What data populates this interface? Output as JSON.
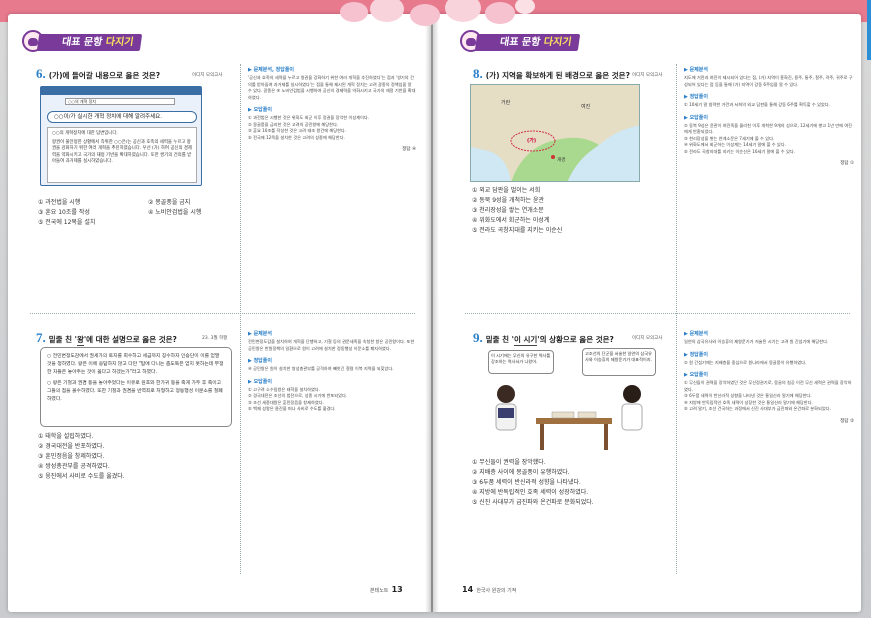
{
  "header": {
    "section_label_a": "대표 문항",
    "section_label_b": "다지기"
  },
  "left": {
    "q6": {
      "number": "6.",
      "title": "(가)에 들어갈 내용으로 옳은 것은?",
      "source": "이디지 모의고사",
      "screen": {
        "url": "○○의 개혁 정치",
        "search_text": "○○이/가 실시한 개혁 정치에 대해 알려주세요.",
        "body_title": "○○의 개혁정치에 대한 답변입니다.",
        "body": "왕권이 불안정한 상황에서 즉위한 ○○은/는 공신과 호족의 세력을 누르고 왕권을 강화하기 위한 여러 개혁을 추진하였습니다. 우선 (가) 하여 공신의 경제력을 약화시키고 국가의 재정 기반을 확대하였습니다. 또한 쌍기의 건의를 받아들여 과거제를 실시하였습니다.",
        "blank": "(가)"
      },
      "choices": [
        "① 과전법을 시행",
        "② 몽골풍을 금지",
        "③ 훈요 10조를 작성",
        "④ 노비안검법을 시행",
        "⑤ 전국에 12목을 설치"
      ],
      "answer": {
        "h1": "▶ 문제분석, 정답풀이",
        "t1": "'공신과 호족의 세력을 누르고 왕권을 강화하기 위한 여러 개혁을 추진하였다'는 점과 '쌍기의 건의를 받아들여 과거제를 실시하였다'는 점을 통해 제시된 개혁 정치는 고려 광종의 정책임을 알 수 있다. 광종은 ④ 노비안검법을 시행하여 공신의 경제력을 약화시키고 국가의 재정 기반을 확대하였다.",
        "h2": "▶ 오답풀이",
        "t2": "① 과전법은 시행한 것은 위화도 회군 이후 정권을 장악한 이성계이다.\n② 몽골풍을 금지한 것은 고려의 공민왕에 해당한다.\n③ 훈요 10조를 작성한 것은 고려 태조 왕건에 해당한다.\n⑤ 전국에 12목을 설치한 것은 고려의 성종에 해당한다.",
        "final": "정답 ④"
      }
    },
    "q7": {
      "number": "7.",
      "title_pre": "밑줄 친 '",
      "title_under": "왕",
      "title_post": "'에 대한 설명으로 옳은 것은?",
      "source": "23. 3월 학평",
      "passage": [
        "○ 전민변정도감에서 권세가의 토지를 회수하고 세금까지 징수하자 인승단이 이를 얻말 것을 청하였다. 왕은 이에 응답하지 않고 다만 \"탐에 다니는 좁도둑은 얻지 못하는데 부정한 자들은 놓아주는 것이 옳다고 하겠는가\"라고 하였다.",
        "○ 왕은 기철과 권겸 등을 놓아주었다는 이유로 원호와 한가귀 등을 죽게 가두 후 죽이고 그들의 점을 몰수하였다. 또한 기철과 권겸을 반역죄로 처형하고 정동행성 이문소를 철폐하였다."
      ],
      "choices": [
        "① 태학을 설립하였다.",
        "② 경국대전을 반포하였다.",
        "③ 훈민정음을 창제하였다.",
        "④ 쌍성총관부를 공격하였다.",
        "⑤ 웅진에서 사비로 수도를 옮겼다."
      ],
      "answer": {
        "h1": "▶ 문제분석",
        "t1": "전민변정도감을 설치하여 개혁을 단행하고, 기철 등의 권문세족을 숙청한 왕은 공민왕이다. 또한 공민왕은 반원정책의 일환으로 원이 고려에 설치한 정동행성 이문소를 폐지하였다.",
        "h2": "▶ 정답풀이",
        "t2": "④ 공민왕은 원이 설치한 쌍성총관부를 공격하여 빼앗긴 철령 이북 지역을 되찾았다.",
        "h3": "▶ 오답풀이",
        "t3": "① 고구려 소수림왕은 태학을 설치하였다.\n② 경국대전은 조선의 법전으로, 성종 시기에 반포되었다.\n③ 조선 세종대왕은 훈민정음을 창제하였다.\n⑤ 백제 성왕은 웅진을 떠나 사비로 수도를 옮겼다."
      }
    },
    "footer": {
      "label": "본테노트",
      "page": "13"
    }
  },
  "right": {
    "q8": {
      "number": "8.",
      "title": "(가) 지역을 확보하게 된 배경으로 옳은 것은?",
      "source": "이디지 모의고사",
      "map": {
        "label_a": "거란",
        "label_b": "여진",
        "label_c": "(가)",
        "label_d": "개경"
      },
      "choices": [
        "① 외교 담판을 벌이는 서희",
        "② 동북 9성을 개척하는 윤관",
        "③ 천리장성을 쌓는 연개소문",
        "④ 위화도에서 회군하는 이성계",
        "⑤ 전라도 곡창지대를 지키는 이순신"
      ],
      "answer": {
        "h1": "▶ 문제분석",
        "t1": "지도에 거란과 여진이 제시되어 있다는 점, (가) 지역이 흥화진, 용주, 통주, 철주, 곽주, 귀주로 구성되어 있다는 점 등을 통해 (가) 지역이 강동 6주임을 알 수 있다.",
        "h2": "▶ 정답풀이",
        "t2": "① 10세기 말 침략한 거란과 서희의 외교 담판을 통해 강동 6주를 획득할 수 있었다.",
        "h3": "▶ 오답풀이",
        "t3": "② 동북 9성은 윤관이 여진족을 물리친 이후 개척한 9개의 성으로, 12세기에 쌓고 1년 만에 여진에게 반환되었다.\n③ 천리장성을 쌓는 연개소문은 7세기에 볼 수 있다.\n④ 위화도에서 회군하는 이성계는 14세기 말에 볼 수 있다.\n⑤ 전라도 곡창지대를 지키는 이순신은 16세기 말에 볼 수 있다.",
        "final": "정답 ①"
      }
    },
    "q9": {
      "number": "9.",
      "title_pre": "밑줄 친 '",
      "title_under": "이 시기",
      "title_post": "'의 상황으로 옳은 것은?",
      "source": "이디지 모의고사",
      "bubble_left": "이 시기에는 무신의 유구한 역사를 강조하는 역사서가 나왔어.",
      "bubble_right": "고조선의 단군을 서술한 일연의 삼국유사와 이승휴의 제왕운기가 대표적이지.",
      "choices": [
        "① 무신들이 권력을 장악했다.",
        "② 지배층 사이에 몽골풍이 유행하였다.",
        "③ 6두품 세력이 반신라적 성향을 나타냈다.",
        "④ 지방에 반독립적인 호족 세력이 성장하였다.",
        "⑤ 신진 사대부가 급진파와 온건파로 분화되었다."
      ],
      "answer": {
        "h1": "▶ 문제분석",
        "t1": "일연의 삼국유사와 이승휴의 제왕운기가 저술된 시기는 고려 원 간섭기에 해당한다.",
        "h2": "▶ 정답풀이",
        "t2": "② 원 간섭기에는 지배층을 중심으로 원나라에서 몽골풍이 유행하였다.",
        "h3": "▶ 오답풀이",
        "t3": "① 무신들이 권력을 장악하였던 것은 무신정권기로, 몽골의 침공 이전 무신 세력은 권력을 장악하였다.\n③ 6두품 세력이 반신라적 성향을 나타낸 것은 통일신라 말기에 해당한다.\n④ 지방에 반독립적인 호족 세력이 성장한 것은 통일신라 말기에 해당한다.\n⑤ 고려 말기, 조선 건국하는 과정에서 신진 사대부가 급진파와 온건파로 분화되었다.",
        "final": "정답 ②"
      }
    },
    "footer": {
      "page": "14",
      "label": "한국사 원강의 기적"
    }
  }
}
